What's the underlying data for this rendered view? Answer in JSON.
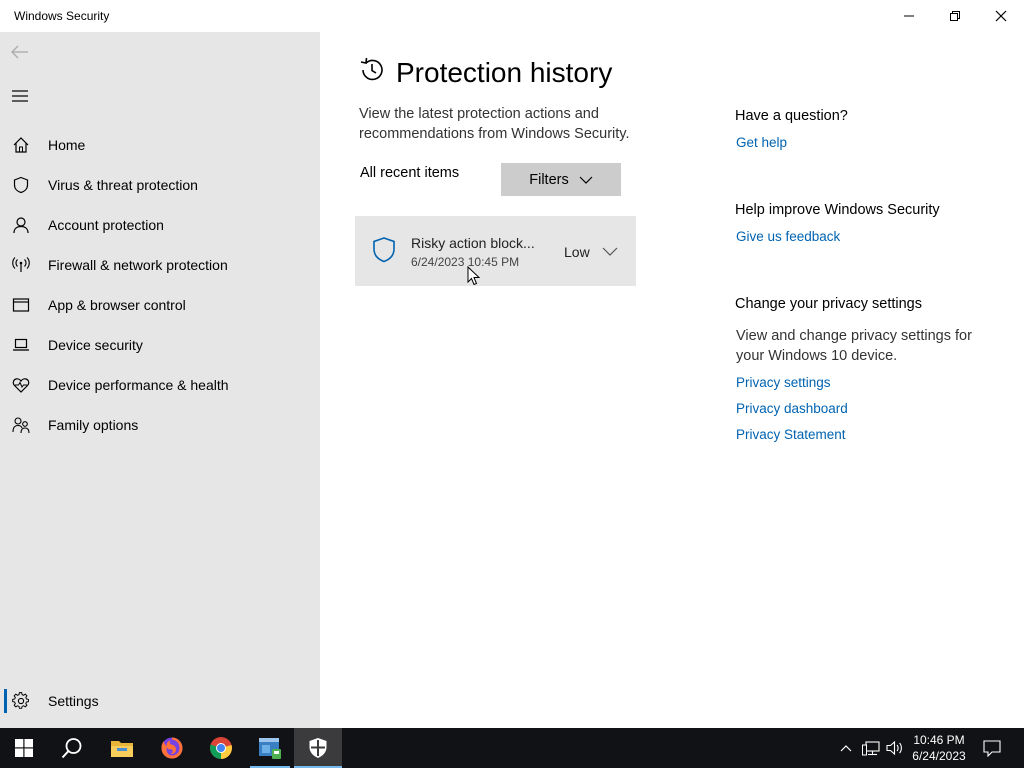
{
  "window": {
    "title": "Windows Security"
  },
  "sidebar": {
    "items": [
      {
        "label": "Home",
        "icon": "home-icon"
      },
      {
        "label": "Virus & threat protection",
        "icon": "shield-icon"
      },
      {
        "label": "Account protection",
        "icon": "person-icon"
      },
      {
        "label": "Firewall & network protection",
        "icon": "antenna-icon"
      },
      {
        "label": "App & browser control",
        "icon": "browser-window-icon"
      },
      {
        "label": "Device security",
        "icon": "laptop-icon"
      },
      {
        "label": "Device performance & health",
        "icon": "heart-pulse-icon"
      },
      {
        "label": "Family options",
        "icon": "family-icon"
      }
    ],
    "settings_label": "Settings"
  },
  "main": {
    "title": "Protection history",
    "description": "View the latest protection actions and recommendations from Windows Security.",
    "recent_label": "All recent items",
    "filters_label": "Filters",
    "history_items": [
      {
        "title": "Risky action block...",
        "date": "6/24/2023 10:45 PM",
        "severity": "Low"
      }
    ]
  },
  "aside": {
    "question_heading": "Have a question?",
    "get_help": "Get help",
    "improve_heading": "Help improve Windows Security",
    "feedback": "Give us feedback",
    "privacy_heading": "Change your privacy settings",
    "privacy_text": "View and change privacy settings for your Windows 10 device.",
    "privacy_settings": "Privacy settings",
    "privacy_dashboard": "Privacy dashboard",
    "privacy_statement": "Privacy Statement"
  },
  "taskbar": {
    "time": "10:46 PM",
    "date": "6/24/2023"
  },
  "colors": {
    "accent": "#0063b1",
    "sidebar_bg": "#e6e6e6",
    "taskbar_bg": "#111215"
  }
}
